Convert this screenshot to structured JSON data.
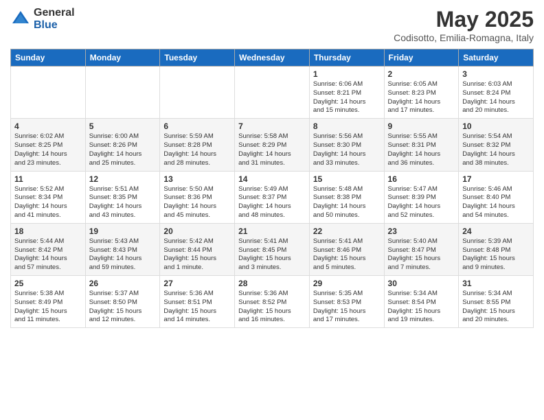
{
  "header": {
    "logo_general": "General",
    "logo_blue": "Blue",
    "month_year": "May 2025",
    "location": "Codisotto, Emilia-Romagna, Italy"
  },
  "weekdays": [
    "Sunday",
    "Monday",
    "Tuesday",
    "Wednesday",
    "Thursday",
    "Friday",
    "Saturday"
  ],
  "weeks": [
    [
      {
        "day": "",
        "info": ""
      },
      {
        "day": "",
        "info": ""
      },
      {
        "day": "",
        "info": ""
      },
      {
        "day": "",
        "info": ""
      },
      {
        "day": "1",
        "info": "Sunrise: 6:06 AM\nSunset: 8:21 PM\nDaylight: 14 hours\nand 15 minutes."
      },
      {
        "day": "2",
        "info": "Sunrise: 6:05 AM\nSunset: 8:23 PM\nDaylight: 14 hours\nand 17 minutes."
      },
      {
        "day": "3",
        "info": "Sunrise: 6:03 AM\nSunset: 8:24 PM\nDaylight: 14 hours\nand 20 minutes."
      }
    ],
    [
      {
        "day": "4",
        "info": "Sunrise: 6:02 AM\nSunset: 8:25 PM\nDaylight: 14 hours\nand 23 minutes."
      },
      {
        "day": "5",
        "info": "Sunrise: 6:00 AM\nSunset: 8:26 PM\nDaylight: 14 hours\nand 25 minutes."
      },
      {
        "day": "6",
        "info": "Sunrise: 5:59 AM\nSunset: 8:28 PM\nDaylight: 14 hours\nand 28 minutes."
      },
      {
        "day": "7",
        "info": "Sunrise: 5:58 AM\nSunset: 8:29 PM\nDaylight: 14 hours\nand 31 minutes."
      },
      {
        "day": "8",
        "info": "Sunrise: 5:56 AM\nSunset: 8:30 PM\nDaylight: 14 hours\nand 33 minutes."
      },
      {
        "day": "9",
        "info": "Sunrise: 5:55 AM\nSunset: 8:31 PM\nDaylight: 14 hours\nand 36 minutes."
      },
      {
        "day": "10",
        "info": "Sunrise: 5:54 AM\nSunset: 8:32 PM\nDaylight: 14 hours\nand 38 minutes."
      }
    ],
    [
      {
        "day": "11",
        "info": "Sunrise: 5:52 AM\nSunset: 8:34 PM\nDaylight: 14 hours\nand 41 minutes."
      },
      {
        "day": "12",
        "info": "Sunrise: 5:51 AM\nSunset: 8:35 PM\nDaylight: 14 hours\nand 43 minutes."
      },
      {
        "day": "13",
        "info": "Sunrise: 5:50 AM\nSunset: 8:36 PM\nDaylight: 14 hours\nand 45 minutes."
      },
      {
        "day": "14",
        "info": "Sunrise: 5:49 AM\nSunset: 8:37 PM\nDaylight: 14 hours\nand 48 minutes."
      },
      {
        "day": "15",
        "info": "Sunrise: 5:48 AM\nSunset: 8:38 PM\nDaylight: 14 hours\nand 50 minutes."
      },
      {
        "day": "16",
        "info": "Sunrise: 5:47 AM\nSunset: 8:39 PM\nDaylight: 14 hours\nand 52 minutes."
      },
      {
        "day": "17",
        "info": "Sunrise: 5:46 AM\nSunset: 8:40 PM\nDaylight: 14 hours\nand 54 minutes."
      }
    ],
    [
      {
        "day": "18",
        "info": "Sunrise: 5:44 AM\nSunset: 8:42 PM\nDaylight: 14 hours\nand 57 minutes."
      },
      {
        "day": "19",
        "info": "Sunrise: 5:43 AM\nSunset: 8:43 PM\nDaylight: 14 hours\nand 59 minutes."
      },
      {
        "day": "20",
        "info": "Sunrise: 5:42 AM\nSunset: 8:44 PM\nDaylight: 15 hours\nand 1 minute."
      },
      {
        "day": "21",
        "info": "Sunrise: 5:41 AM\nSunset: 8:45 PM\nDaylight: 15 hours\nand 3 minutes."
      },
      {
        "day": "22",
        "info": "Sunrise: 5:41 AM\nSunset: 8:46 PM\nDaylight: 15 hours\nand 5 minutes."
      },
      {
        "day": "23",
        "info": "Sunrise: 5:40 AM\nSunset: 8:47 PM\nDaylight: 15 hours\nand 7 minutes."
      },
      {
        "day": "24",
        "info": "Sunrise: 5:39 AM\nSunset: 8:48 PM\nDaylight: 15 hours\nand 9 minutes."
      }
    ],
    [
      {
        "day": "25",
        "info": "Sunrise: 5:38 AM\nSunset: 8:49 PM\nDaylight: 15 hours\nand 11 minutes."
      },
      {
        "day": "26",
        "info": "Sunrise: 5:37 AM\nSunset: 8:50 PM\nDaylight: 15 hours\nand 12 minutes."
      },
      {
        "day": "27",
        "info": "Sunrise: 5:36 AM\nSunset: 8:51 PM\nDaylight: 15 hours\nand 14 minutes."
      },
      {
        "day": "28",
        "info": "Sunrise: 5:36 AM\nSunset: 8:52 PM\nDaylight: 15 hours\nand 16 minutes."
      },
      {
        "day": "29",
        "info": "Sunrise: 5:35 AM\nSunset: 8:53 PM\nDaylight: 15 hours\nand 17 minutes."
      },
      {
        "day": "30",
        "info": "Sunrise: 5:34 AM\nSunset: 8:54 PM\nDaylight: 15 hours\nand 19 minutes."
      },
      {
        "day": "31",
        "info": "Sunrise: 5:34 AM\nSunset: 8:55 PM\nDaylight: 15 hours\nand 20 minutes."
      }
    ]
  ]
}
